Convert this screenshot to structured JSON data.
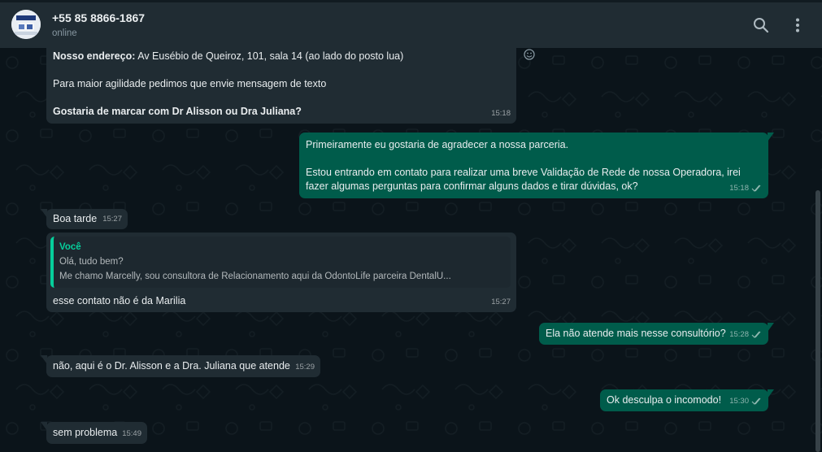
{
  "header": {
    "contact_name": "+55 85 8866-1867",
    "status": "online",
    "icons": [
      "search-icon",
      "menu-icon"
    ]
  },
  "colors": {
    "incoming": "#202c33",
    "outgoing": "#005c4b",
    "accent": "#06cf9c",
    "background": "#0b141a"
  },
  "messages": {
    "m1": {
      "line1_bold": "Nosso endereço:",
      "line1_rest": " Av Eusébio de Queiroz, 101, sala 14 (ao lado do posto lua)",
      "line2": "Para maior agilidade pedimos que envie mensagem de texto",
      "line3_bold": "Gostaria de marcar com Dr Alisson ou Dra Juliana?",
      "time": "15:18"
    },
    "m2": {
      "line1": "Primeiramente eu gostaria de agradecer a nossa parceria.",
      "line2": "Estou entrando em contato para realizar uma breve Validação de Rede de nossa Operadora, irei",
      "line3": "fazer algumas perguntas para confirmar alguns dados e tirar dúvidas, ok?",
      "time": "15:18"
    },
    "m3": {
      "text": "Boa tarde",
      "time": "15:27"
    },
    "m4": {
      "quote_author": "Você",
      "quote_line1": "Olá, tudo bem?",
      "quote_line2": "Me chamo Marcelly, sou consultora de Relacionamento aqui da OdontoLife parceira DentalU...",
      "text": "esse contato não é da Marilia",
      "time": "15:27"
    },
    "m5": {
      "text": "Ela não atende mais nesse consultório?",
      "time": "15:28"
    },
    "m6": {
      "text": "não, aqui é o Dr. Alisson e a Dra. Juliana que atende",
      "time": "15:29"
    },
    "m7": {
      "text": "Ok desculpa o incomodo!",
      "time": "15:30"
    },
    "m8": {
      "text": "sem problema",
      "time": "15:49"
    }
  }
}
